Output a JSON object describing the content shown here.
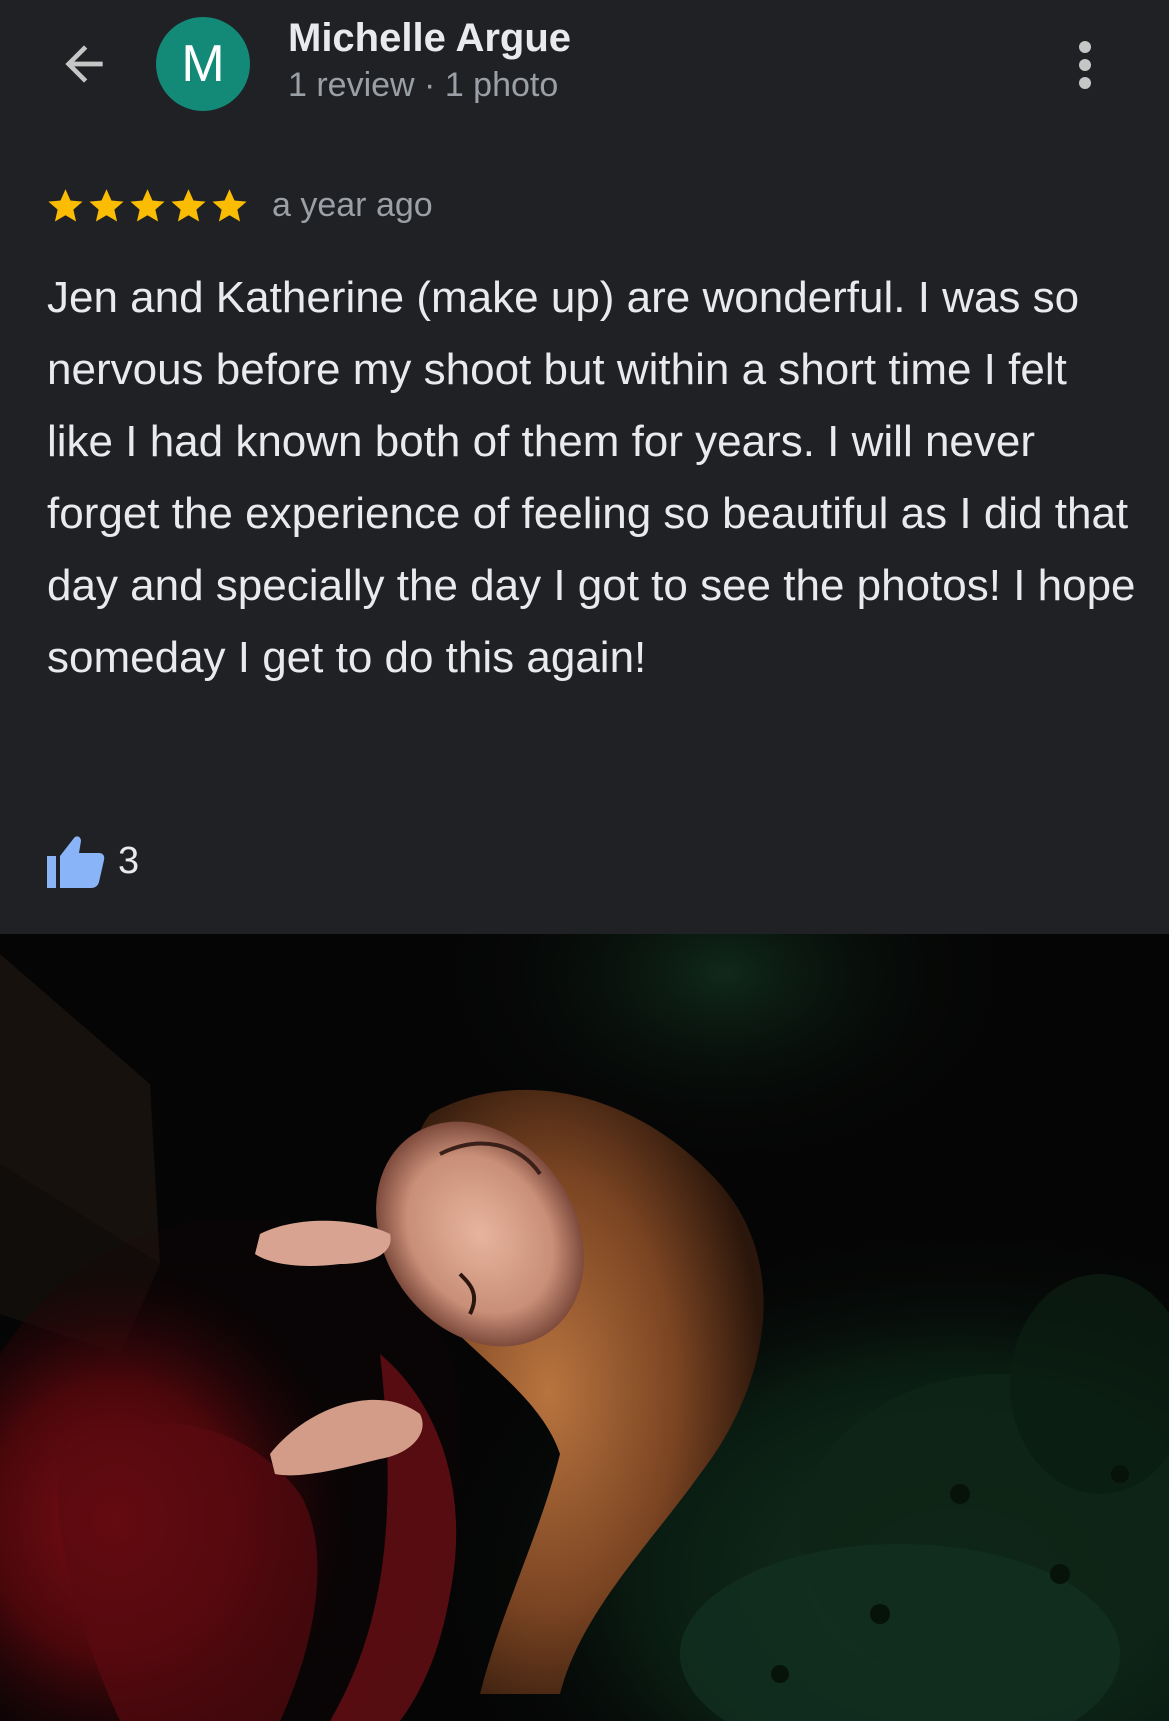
{
  "header": {
    "back_icon": "arrow-left-icon",
    "avatar_letter": "M",
    "avatar_color": "#138a78",
    "user_name": "Michelle Argue",
    "user_meta": "1 review · 1 photo",
    "more_icon": "more-vert-icon"
  },
  "review": {
    "rating": 5,
    "max_rating": 5,
    "star_icon": "star-icon",
    "star_color": "#fbbc04",
    "time_ago": "a year ago",
    "text": "Jen and Katherine (make up) are wonderful. I was so nervous before my shoot but within a short time I felt like I had known both of them for years. I will never forget the experience of feeling so beautiful as I did that day and specially the day I got to see the photos! I hope someday I get to do this again!",
    "like_icon": "thumbs-up-icon",
    "like_color": "#8ab4f8",
    "like_count": "3"
  },
  "photo": {
    "icon": "review-photo"
  },
  "theme": {
    "background": "#202124",
    "text_primary": "#e8eaed",
    "text_secondary": "#9aa0a6"
  }
}
